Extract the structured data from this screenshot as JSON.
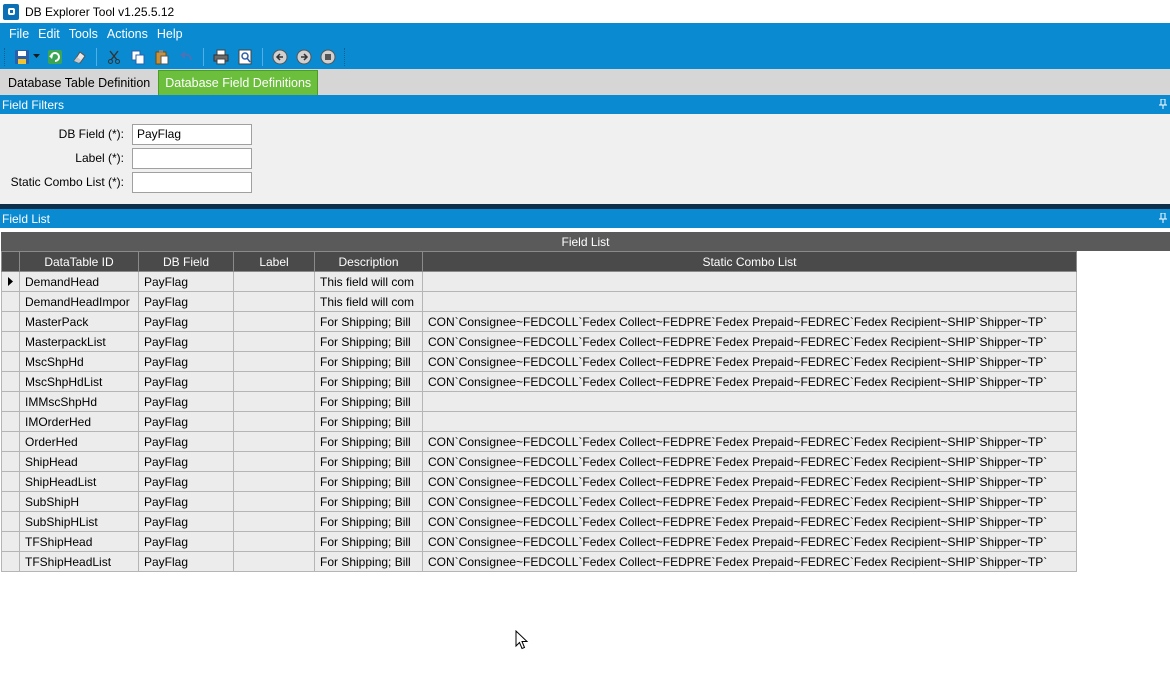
{
  "window": {
    "title": "DB Explorer Tool v1.25.5.12",
    "icon": "app-logo-icon"
  },
  "menu": [
    "File",
    "Edit",
    "Tools",
    "Actions",
    "Help"
  ],
  "toolbar": {
    "icons": [
      "save-icon",
      "dropdown-arrow-icon",
      "refresh-icon",
      "clear-icon",
      "cut-icon",
      "copy-icon",
      "paste-icon",
      "undo-icon",
      "print-icon",
      "print-preview-icon",
      "back-icon",
      "forward-icon",
      "stop-icon"
    ]
  },
  "tabs": [
    {
      "label": "Database Table Definition",
      "active": false
    },
    {
      "label": "Database Field Definitions",
      "active": true
    }
  ],
  "filters_panel": {
    "title": "Field Filters",
    "fields": [
      {
        "label": "DB Field (*):",
        "value": "PayFlag"
      },
      {
        "label": "Label (*):",
        "value": ""
      },
      {
        "label": "Static Combo List (*):",
        "value": ""
      }
    ]
  },
  "list_panel": {
    "title": "Field List",
    "caption": "Field List",
    "columns": [
      "DataTable ID",
      "DB Field",
      "Label",
      "Description",
      "Static Combo List"
    ],
    "rows": [
      [
        "DemandHead",
        "PayFlag",
        "",
        "This field will com",
        ""
      ],
      [
        "DemandHeadImpor",
        "PayFlag",
        "",
        "This field will com",
        ""
      ],
      [
        "MasterPack",
        "PayFlag",
        "",
        "For Shipping; Bill",
        "CON`Consignee~FEDCOLL`Fedex Collect~FEDPRE`Fedex Prepaid~FEDREC`Fedex Recipient~SHIP`Shipper~TP`"
      ],
      [
        "MasterpackList",
        "PayFlag",
        "",
        "For Shipping; Bill",
        "CON`Consignee~FEDCOLL`Fedex Collect~FEDPRE`Fedex Prepaid~FEDREC`Fedex Recipient~SHIP`Shipper~TP`"
      ],
      [
        "MscShpHd",
        "PayFlag",
        "",
        "For Shipping; Bill",
        "CON`Consignee~FEDCOLL`Fedex Collect~FEDPRE`Fedex Prepaid~FEDREC`Fedex Recipient~SHIP`Shipper~TP`"
      ],
      [
        "MscShpHdList",
        "PayFlag",
        "",
        "For Shipping; Bill",
        "CON`Consignee~FEDCOLL`Fedex Collect~FEDPRE`Fedex Prepaid~FEDREC`Fedex Recipient~SHIP`Shipper~TP`"
      ],
      [
        "IMMscShpHd",
        "PayFlag",
        "",
        "For Shipping; Bill",
        ""
      ],
      [
        "IMOrderHed",
        "PayFlag",
        "",
        "For Shipping; Bill",
        ""
      ],
      [
        "OrderHed",
        "PayFlag",
        "",
        "For Shipping; Bill",
        "CON`Consignee~FEDCOLL`Fedex Collect~FEDPRE`Fedex Prepaid~FEDREC`Fedex Recipient~SHIP`Shipper~TP`"
      ],
      [
        "ShipHead",
        "PayFlag",
        "",
        "For Shipping; Bill",
        "CON`Consignee~FEDCOLL`Fedex Collect~FEDPRE`Fedex Prepaid~FEDREC`Fedex Recipient~SHIP`Shipper~TP`"
      ],
      [
        "ShipHeadList",
        "PayFlag",
        "",
        "For Shipping; Bill",
        "CON`Consignee~FEDCOLL`Fedex Collect~FEDPRE`Fedex Prepaid~FEDREC`Fedex Recipient~SHIP`Shipper~TP`"
      ],
      [
        "SubShipH",
        "PayFlag",
        "",
        "For Shipping; Bill",
        "CON`Consignee~FEDCOLL`Fedex Collect~FEDPRE`Fedex Prepaid~FEDREC`Fedex Recipient~SHIP`Shipper~TP`"
      ],
      [
        "SubShipHList",
        "PayFlag",
        "",
        "For Shipping; Bill",
        "CON`Consignee~FEDCOLL`Fedex Collect~FEDPRE`Fedex Prepaid~FEDREC`Fedex Recipient~SHIP`Shipper~TP`"
      ],
      [
        "TFShipHead",
        "PayFlag",
        "",
        "For Shipping; Bill",
        "CON`Consignee~FEDCOLL`Fedex Collect~FEDPRE`Fedex Prepaid~FEDREC`Fedex Recipient~SHIP`Shipper~TP`"
      ],
      [
        "TFShipHeadList",
        "PayFlag",
        "",
        "For Shipping; Bill",
        "CON`Consignee~FEDCOLL`Fedex Collect~FEDPRE`Fedex Prepaid~FEDREC`Fedex Recipient~SHIP`Shipper~TP`"
      ]
    ]
  },
  "colors": {
    "accent": "#0a8ad0",
    "active_tab": "#6cbf3c",
    "grid_header": "#4a4a4a",
    "divider": "#0d2f4a"
  }
}
